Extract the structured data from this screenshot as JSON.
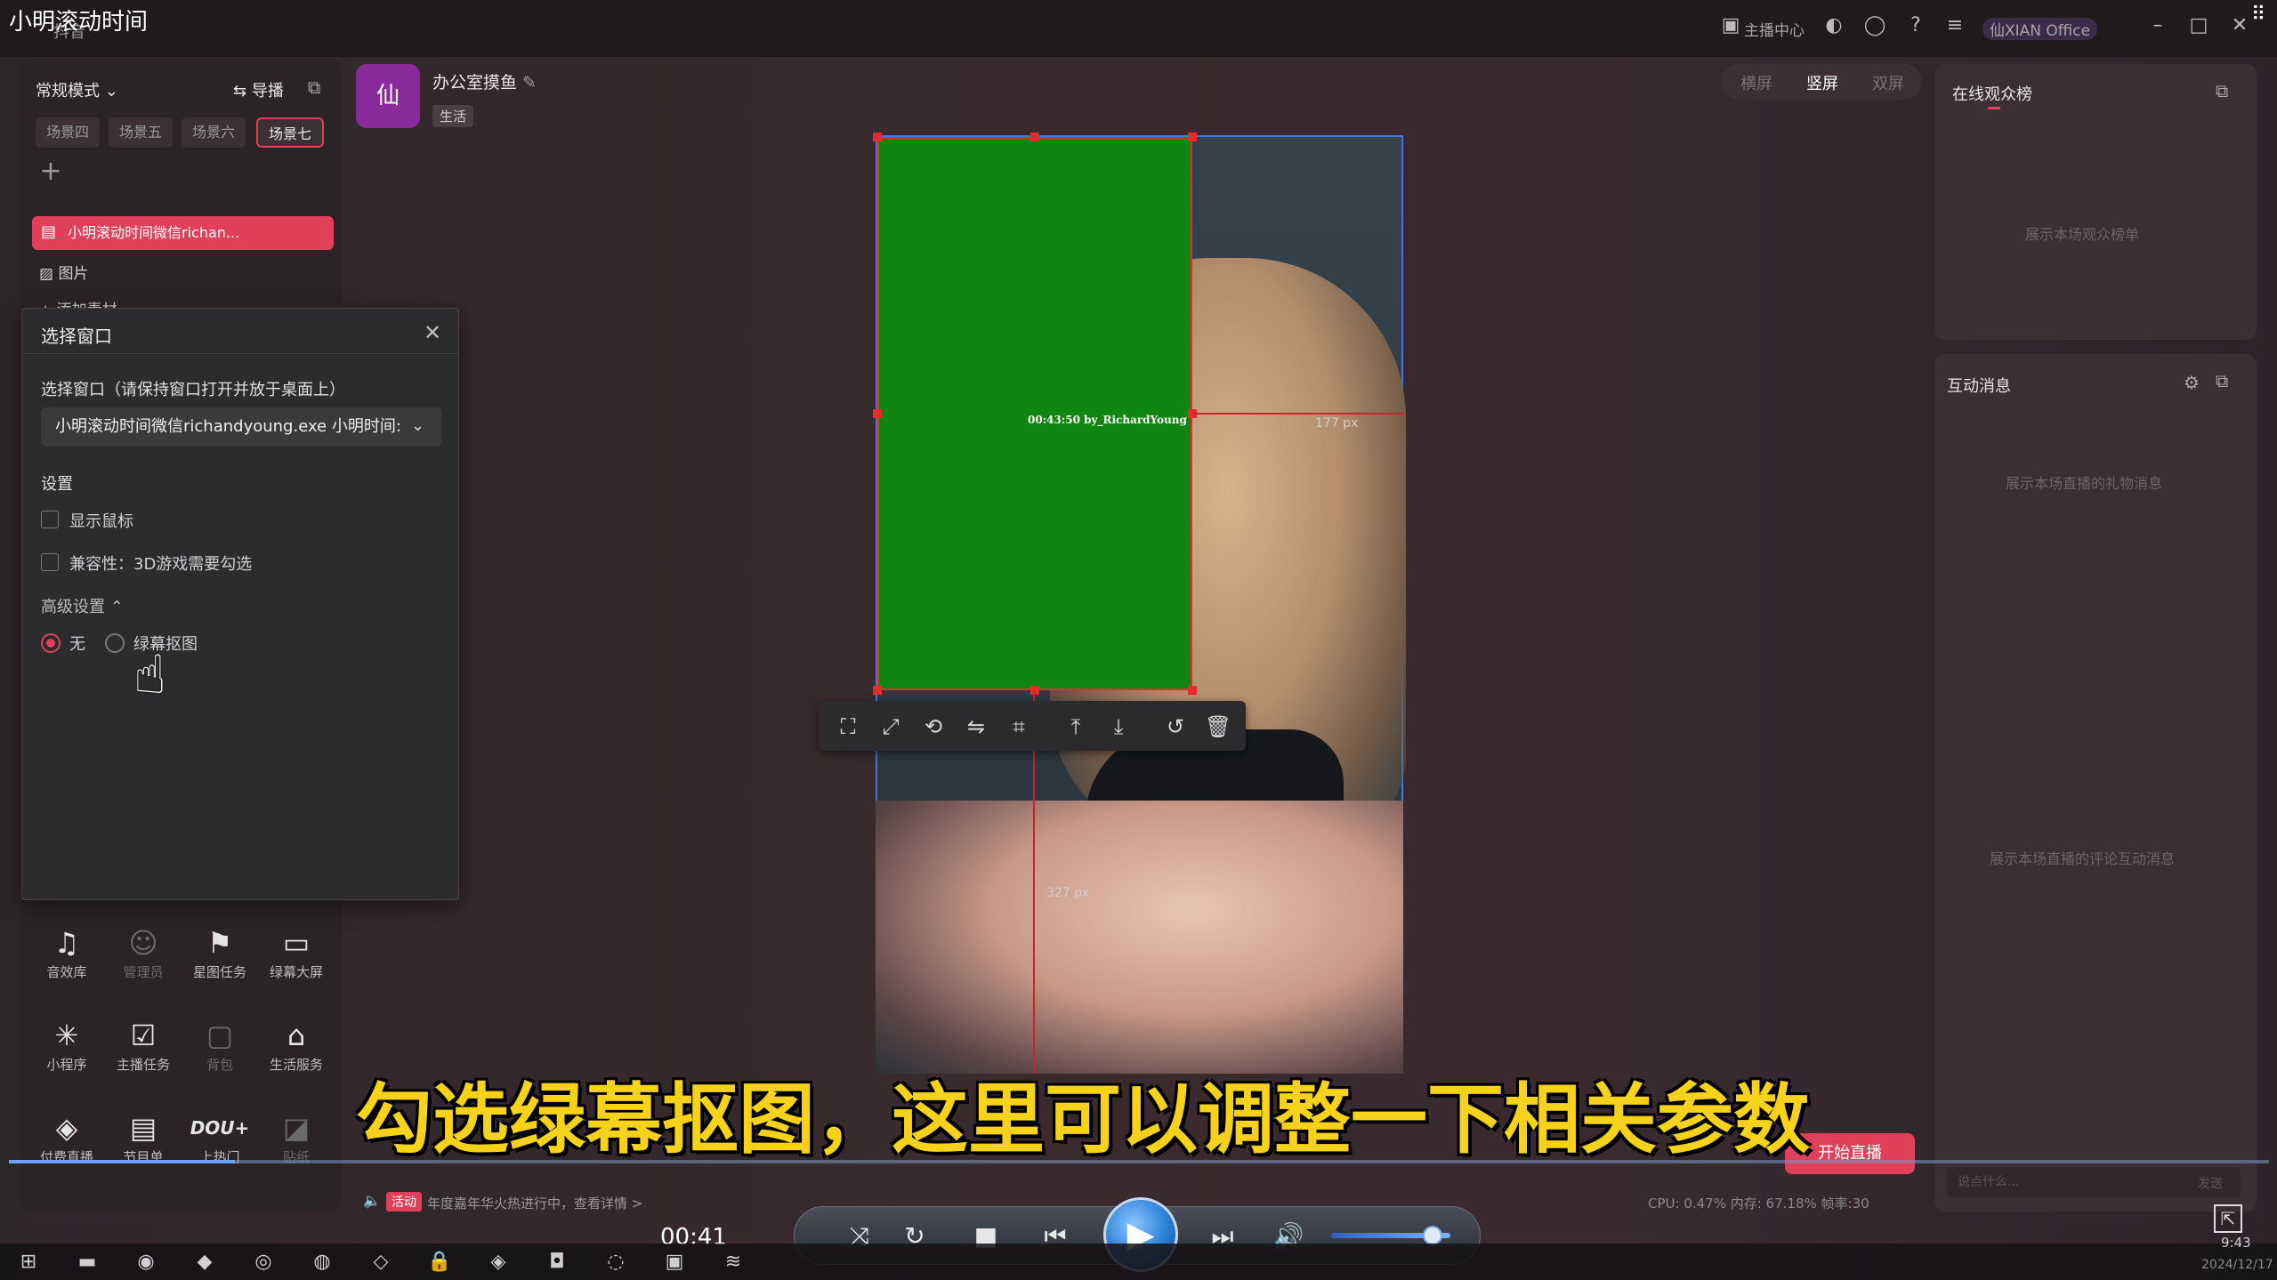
{
  "video": {
    "title": "小明滚动时间",
    "current_time": "00:41",
    "progress": 0.1,
    "volume": 0.85
  },
  "app": {
    "name": "抖音",
    "titlebar": {
      "broadcaster_center": "主播中心",
      "user": "仙XIAN Office"
    }
  },
  "left_panel": {
    "mode": "常规模式",
    "guide": "导播",
    "scenes": [
      "场景四",
      "场景五",
      "场景六",
      "场景七"
    ],
    "active_scene": "场景七",
    "sources": {
      "active": "小明滚动时间微信richan...",
      "image": "图片",
      "add_material": "添加素材"
    },
    "tools": [
      {
        "label": "音效库",
        "icon": "sound-effect-icon",
        "enabled": true
      },
      {
        "label": "管理员",
        "icon": "admin-icon",
        "enabled": false
      },
      {
        "label": "星图任务",
        "icon": "star-task-icon",
        "enabled": true
      },
      {
        "label": "绿幕大屏",
        "icon": "green-screen-icon",
        "enabled": true
      },
      {
        "label": "小程序",
        "icon": "mini-program-icon",
        "enabled": true
      },
      {
        "label": "主播任务",
        "icon": "anchor-task-icon",
        "enabled": true
      },
      {
        "label": "背包",
        "icon": "backpack-icon",
        "enabled": false
      },
      {
        "label": "生活服务",
        "icon": "life-service-icon",
        "enabled": true
      },
      {
        "label": "付费直播",
        "icon": "paid-live-icon",
        "enabled": true
      },
      {
        "label": "节目单",
        "icon": "program-list-icon",
        "enabled": true
      },
      {
        "label": "上热门",
        "icon": "dou-plus-icon",
        "enabled": true
      },
      {
        "label": "贴纸",
        "icon": "sticker-icon",
        "enabled": false
      }
    ]
  },
  "dialog": {
    "title": "选择窗口",
    "window_label": "选择窗口（请保持窗口打开并放于桌面上）",
    "window_value": "小明滚动时间微信richandyoung.exe 小明时间:",
    "settings_label": "设置",
    "show_cursor": "显示鼠标",
    "compat": "兼容性：3D游戏需要勾选",
    "advanced_label": "高级设置",
    "radio_none": "无",
    "radio_chroma": "绿幕抠图",
    "selected": "无"
  },
  "room": {
    "avatar_text": "仙",
    "name": "办公室摸鱼",
    "tag": "生活"
  },
  "layout_modes": [
    "横屏",
    "竖屏",
    "双屏"
  ],
  "active_layout": "竖屏",
  "preview": {
    "overlay_text": "00:43:50 by_RichardYoung",
    "guide_px_1": "177 px",
    "guide_px_2": "327 px"
  },
  "right_panel": {
    "viewers_title": "在线观众榜",
    "viewers_empty": "展示本场观众榜单",
    "msg_title": "互动消息",
    "gift_empty": "展示本场直播的礼物消息",
    "comment_empty": "展示本场直播的评论互动消息",
    "input_placeholder": "说点什么...",
    "send": "发送"
  },
  "bottom": {
    "live_btn": "开始直播",
    "notice_badge": "活动",
    "notice": "年度嘉年华火热进行中，查看详情 >",
    "stats": "CPU: 0.47%   内存: 67.18%   帧率:30"
  },
  "subtitle": "勾选绿幕抠图，这里可以调整一下相关参数",
  "taskbar": {
    "time": "9:43",
    "date": "2024/12/17"
  },
  "colors": {
    "accent": "#e0405a",
    "subtitle": "#f7d21a",
    "green_screen": "#118511",
    "selection": "#e62b2b",
    "frame": "#3f7bd6"
  }
}
